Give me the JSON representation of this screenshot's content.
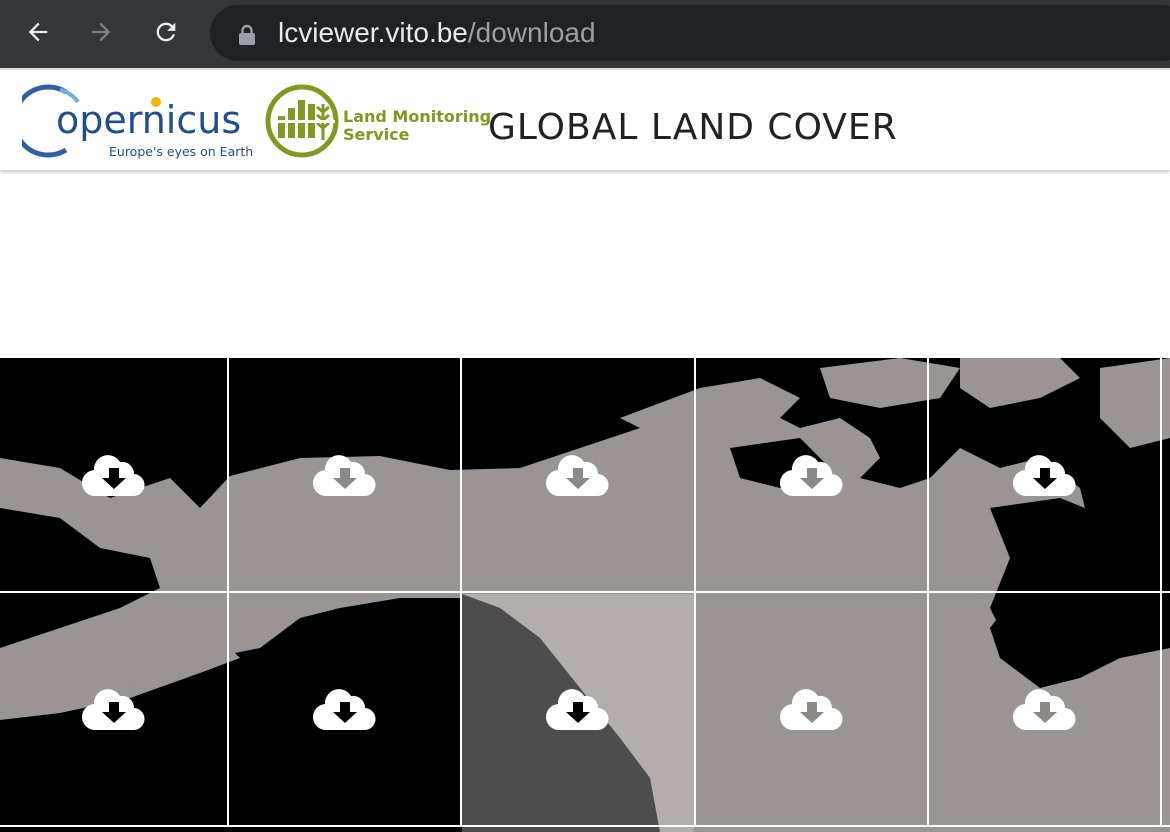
{
  "browser": {
    "url_host": "lcviewer.vito.be",
    "url_path": "/download",
    "icons": [
      "back-arrow-icon",
      "forward-arrow-icon",
      "reload-icon",
      "lock-icon"
    ]
  },
  "header": {
    "copernicus": {
      "word": "opernicus",
      "tagline": "Europe's eyes on Earth"
    },
    "lms": {
      "line1": "Land Monitoring",
      "line2": "Service"
    },
    "title": "GLOBAL LAND COVER"
  },
  "colors": {
    "land": "#9a9593",
    "land_light": "#b3aeac",
    "land_dark": "#4d4d4d",
    "water": "#000000",
    "copernicus_blue": "#1f4e8c",
    "lms_green": "#7f9a1f"
  },
  "tiles": [
    {
      "row": 1,
      "col": 1,
      "icon": "cloud-download-icon",
      "arrow": "black"
    },
    {
      "row": 1,
      "col": 2,
      "icon": "cloud-download-icon",
      "arrow": "grey"
    },
    {
      "row": 1,
      "col": 3,
      "icon": "cloud-download-icon",
      "arrow": "grey"
    },
    {
      "row": 1,
      "col": 4,
      "icon": "cloud-download-icon",
      "arrow": "grey"
    },
    {
      "row": 1,
      "col": 5,
      "icon": "cloud-download-icon",
      "arrow": "black"
    },
    {
      "row": 2,
      "col": 1,
      "icon": "cloud-download-icon",
      "arrow": "black"
    },
    {
      "row": 2,
      "col": 2,
      "icon": "cloud-download-icon",
      "arrow": "black"
    },
    {
      "row": 2,
      "col": 3,
      "icon": "cloud-download-icon",
      "arrow": "black"
    },
    {
      "row": 2,
      "col": 4,
      "icon": "cloud-download-icon",
      "arrow": "grey"
    },
    {
      "row": 2,
      "col": 5,
      "icon": "cloud-download-icon",
      "arrow": "grey"
    }
  ]
}
